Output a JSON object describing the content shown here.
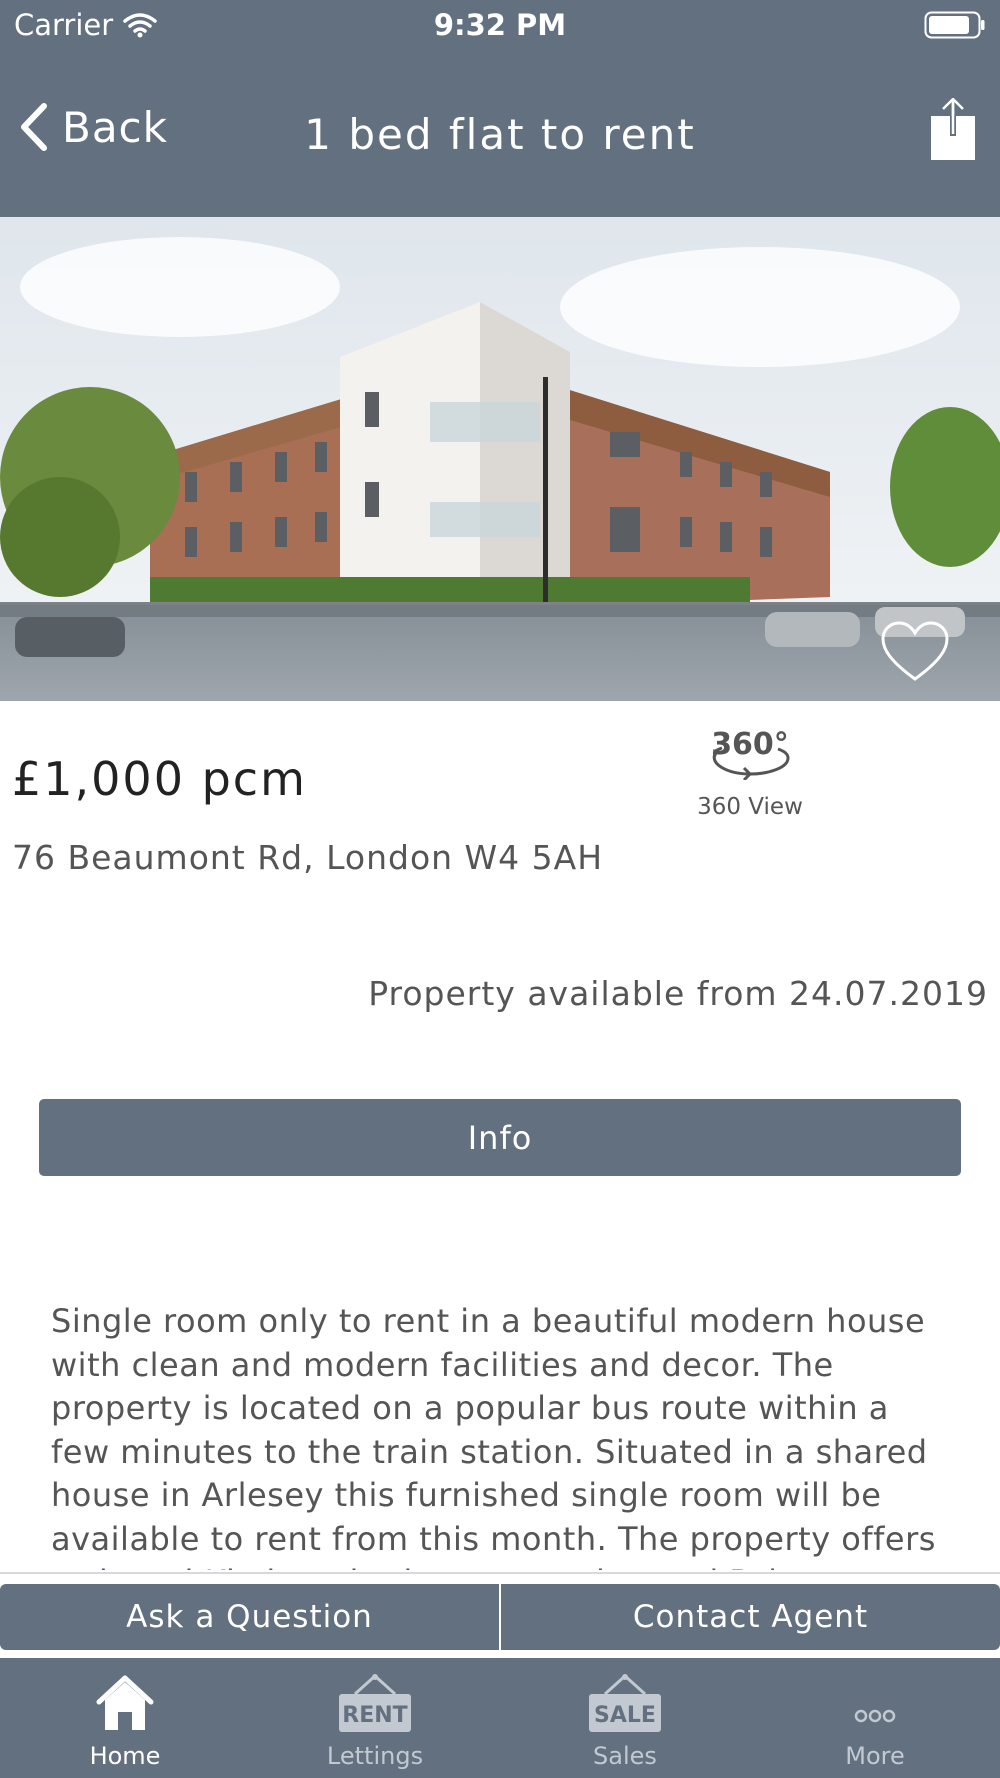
{
  "status_bar": {
    "carrier": "Carrier",
    "time": "9:32 PM"
  },
  "nav": {
    "back_label": "Back",
    "title": "1 bed flat to rent"
  },
  "property": {
    "price": "£1,000 pcm",
    "address": "76 Beaumont Rd, London W4 5AH",
    "view360_label": "360 View",
    "view360_icon_text": "360°",
    "availability": "Property available from 24.07.2019",
    "info_button": "Info",
    "description": "Single room only to rent in a beautiful modern house with clean and modern facilities and decor. The property is located on a popular bus route within a few minutes to the train station. Situated in a shared house in Arlesey this furnished single room will be available to rent from this month. The property offers a shared Kitchen, bathroom, garden and Drive..."
  },
  "actions": {
    "ask": "Ask a Question",
    "contact": "Contact Agent"
  },
  "tabs": [
    {
      "label": "Home",
      "icon": "home-icon",
      "active": true
    },
    {
      "label": "Lettings",
      "icon": "rent-sign-icon",
      "icon_text": "RENT",
      "active": false
    },
    {
      "label": "Sales",
      "icon": "sale-sign-icon",
      "icon_text": "SALE",
      "active": false
    },
    {
      "label": "More",
      "icon": "more-icon",
      "active": false
    }
  ],
  "colors": {
    "primary": "#627080",
    "text": "#555555",
    "price": "#222222"
  }
}
